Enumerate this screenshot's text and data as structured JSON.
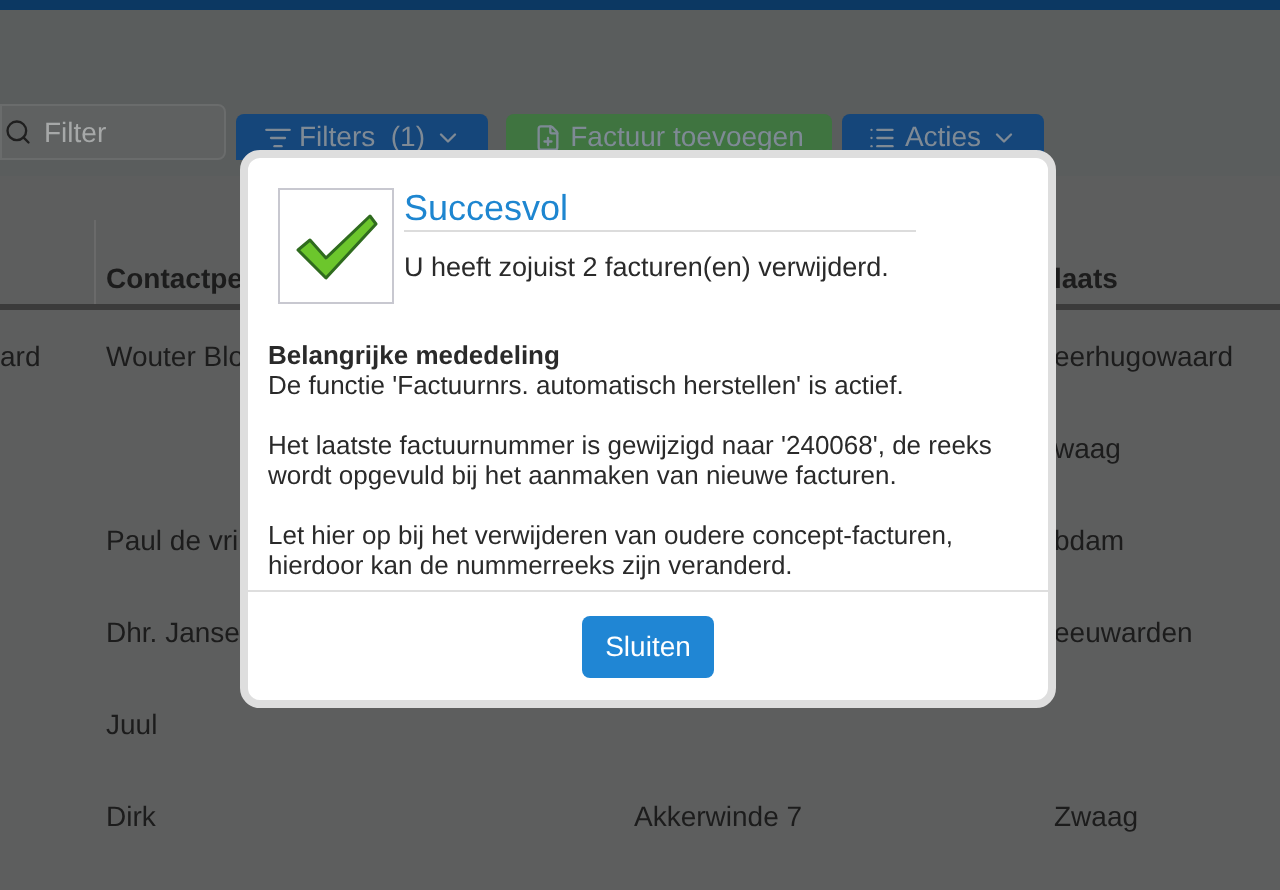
{
  "toolbar": {
    "filter": {
      "placeholder": "Filter"
    },
    "buttons": [
      {
        "kind": "filters",
        "label": "Filters  (1)"
      },
      {
        "kind": "add",
        "label": "Factuur toevoegen"
      },
      {
        "kind": "actions",
        "label": "Acties"
      }
    ]
  },
  "table": {
    "header": {
      "column_2": "Contactpe",
      "column_4": "laats"
    },
    "rows": [
      {
        "column_1": "ard",
        "column_2": "Wouter Blo",
        "column_4": "eerhugowaard"
      },
      {
        "column_4": "waag"
      },
      {
        "column_2": "Paul de vri",
        "column_4": "bdam"
      },
      {
        "column_2": "Dhr. Janse",
        "column_4": "eeuwarden"
      },
      {
        "column_2": "Juul"
      },
      {
        "column_2": "Dirk",
        "column_3": "Akkerwinde 7",
        "column_4": "Zwaag"
      }
    ]
  },
  "dialog": {
    "title": "Succesvol",
    "message": "U heeft zojuist 2 facturen(en) verwijderd.",
    "notice_heading": "Belangrijke mededeling",
    "paragraphs": [
      "De functie 'Factuurnrs. automatisch herstellen' is actief.",
      "Het laatste factuurnummer is gewijzigd naar '240068', de reeks wordt opgevuld bij het aanmaken van nieuwe facturen.",
      "Let hier op bij het verwijderen van oudere concept-facturen, hierdoor kan de nummerreeks zijn veranderd."
    ],
    "close_button": "Sluiten"
  }
}
